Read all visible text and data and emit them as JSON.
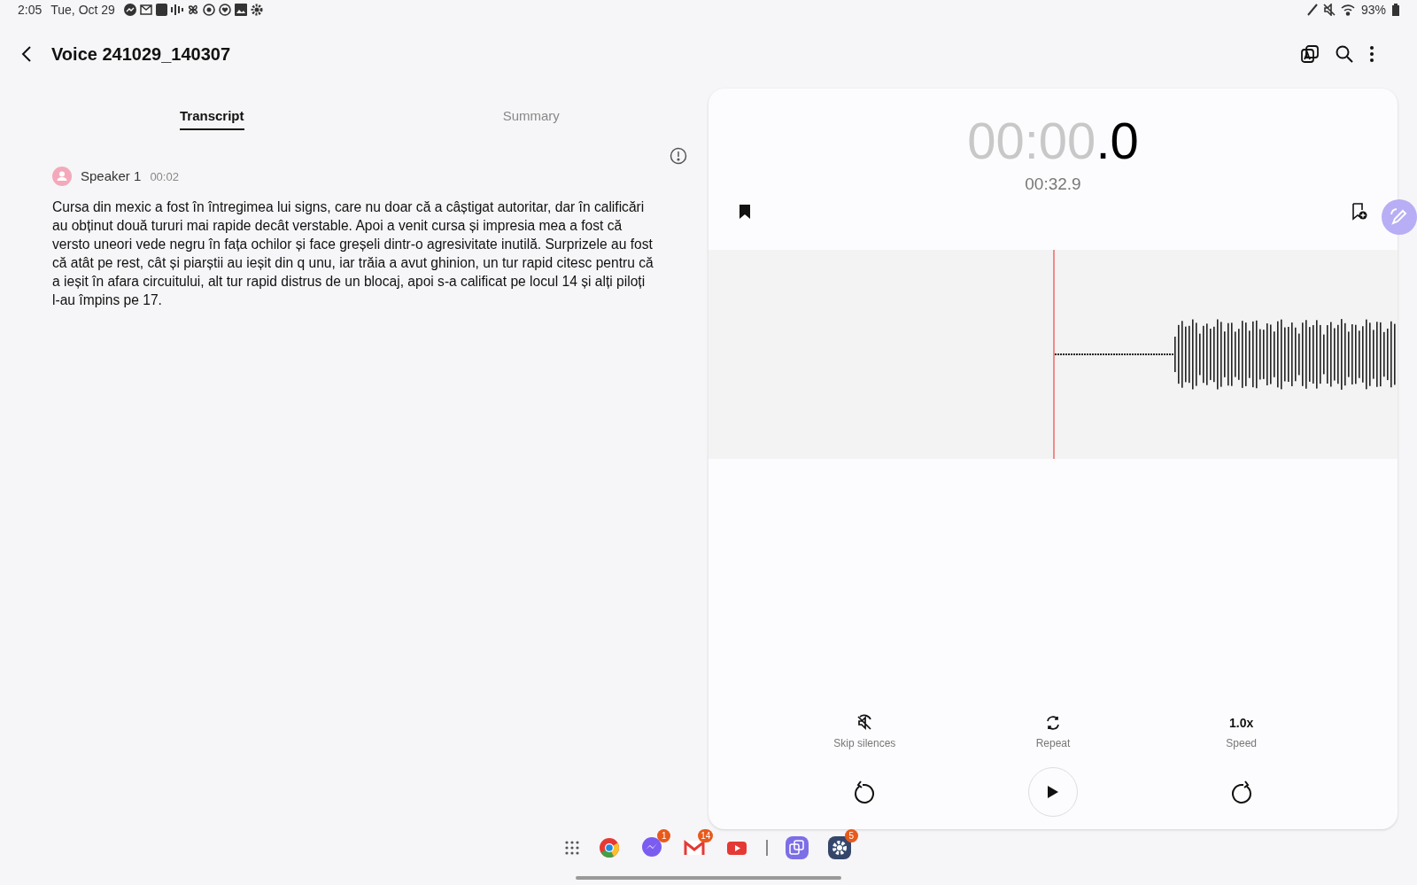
{
  "status_bar": {
    "time": "2:05",
    "date": "Tue, Oct 29",
    "battery": "93%"
  },
  "header": {
    "title": "Voice 241029_140307"
  },
  "tabs": [
    {
      "label": "Transcript",
      "selected": true
    },
    {
      "label": "Summary",
      "selected": false
    }
  ],
  "transcript": {
    "speaker": "Speaker 1",
    "time": "00:02",
    "text": "Cursa din mexic a fost în întregimea lui signs, care nu doar că a câștigat autoritar, dar în calificări au obținut două tururi mai rapide decât verstable. Apoi a venit cursa și impresia mea a fost că versto uneori vede negru în fața ochilor și face greșeli dintr-o agresivitate inutilă. Surprizele au fost că atât pe rest, cât și piarștii au ieșit din q unu, iar trăia a avut ghinion, un tur rapid citesc pentru că a ieșit în afara circuitului, alt tur rapid distrus de un blocaj, apoi s-a calificat pe locul 14 și alți piloți l-au împins pe 17."
  },
  "player": {
    "elapsed": "00:00",
    "elapsed_tenths": ".0",
    "duration": "00:32.9",
    "options": [
      {
        "kind": "skip",
        "label": "Skip silences"
      },
      {
        "kind": "repeat",
        "label": "Repeat"
      },
      {
        "kind": "speed",
        "value": "1.0x",
        "label": "Speed"
      }
    ]
  },
  "taskbar": [
    {
      "kind": "chrome"
    },
    {
      "kind": "messenger",
      "badge": "1"
    },
    {
      "kind": "gmail",
      "badge": "14"
    },
    {
      "kind": "youtube"
    },
    {
      "kind": "divider"
    },
    {
      "kind": "translate"
    },
    {
      "kind": "settings",
      "badge": "5"
    }
  ]
}
